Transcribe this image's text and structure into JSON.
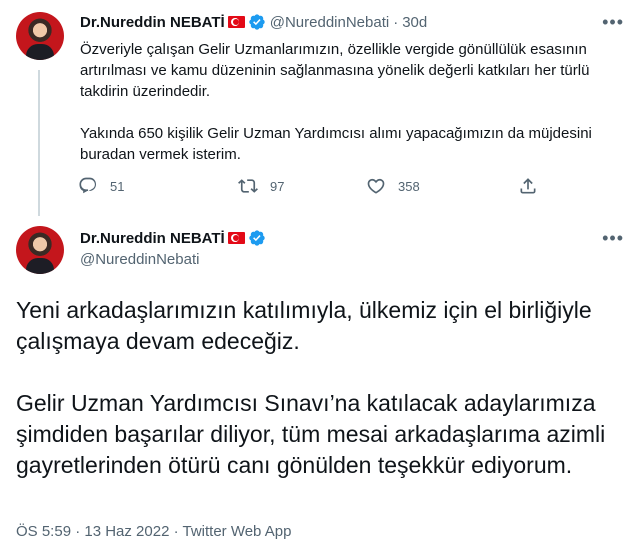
{
  "tweet1": {
    "author_name": "Dr.Nureddin NEBATİ",
    "handle": "@NureddinNebati",
    "time": "30d",
    "paragraphs": [
      "Özveriyle çalışan Gelir Uzmanlarımızın, özellikle vergide gönüllülük esasının artırılması ve kamu düzeninin sağlanmasına yönelik değerli katkıları her türlü takdirin üzerindedir.",
      "Yakında 650 kişilik Gelir Uzman Yardımcısı alımı yapacağımızın da müjdesini buradan vermek isterim."
    ],
    "replies": "51",
    "retweets": "97",
    "likes": "358"
  },
  "tweet2": {
    "author_name": "Dr.Nureddin NEBATİ",
    "handle": "@NureddinNebati",
    "paragraphs": [
      "Yeni arkadaşlarımızın katılımıyla, ülkemiz için el birliğiyle çalışmaya devam edeceğiz.",
      "Gelir Uzman Yardımcısı Sınavı’na katılacak adaylarımıza şimdiden başarılar diliyor, tüm mesai arkadaşlarıma azimli gayretlerinden ötürü canı gönülden teşekkür ediyorum."
    ],
    "timestamp": "ÖS 5:59 · 13 Haz 2022 · Twitter Web App"
  },
  "icons": {
    "more": "more-horizontal-icon",
    "reply": "reply-icon",
    "retweet": "retweet-icon",
    "like": "heart-icon",
    "share": "share-icon",
    "verified": "verified-badge-icon",
    "flag": "turkey-flag-icon"
  },
  "colors": {
    "text": "#0f1419",
    "secondary": "#536471",
    "verified": "#1d9bf0",
    "flag": "#e30a17"
  }
}
